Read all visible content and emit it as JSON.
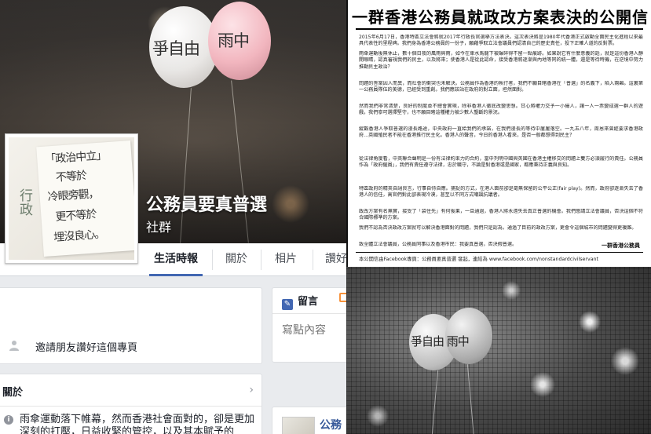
{
  "cover": {
    "balloon_left_text": "爭自由",
    "balloon_right_text": "雨中"
  },
  "profile": {
    "note_lines": [
      "「政治中立」",
      "不等於",
      "冷眼旁觀，",
      "更不等於",
      "埋沒良心。"
    ],
    "side_note": "行政"
  },
  "page": {
    "name": "公務員要真普選",
    "category": "社群"
  },
  "tabs": [
    {
      "label": "生活時報",
      "active": true
    },
    {
      "label": "關於",
      "active": false
    },
    {
      "label": "相片",
      "active": false
    },
    {
      "label": "讚好",
      "active": false
    }
  ],
  "invite": {
    "text": "邀請朋友讚好這個專頁"
  },
  "about": {
    "title": "關於",
    "text": "雨傘運動落下帷幕，然而香港社會面對的，卻是更加深刻的打壓，日益收緊的管控，以及其本賦予的"
  },
  "composer": {
    "tab_label": "留言",
    "placeholder": "寫點內容"
  },
  "post": {
    "name": "公務"
  },
  "letter": {
    "title": "一群香港公務員就政改方案表決的公開信",
    "paragraphs": [
      "2015年6月17日，香港特區立法會將就2017年行政長官選舉方法表決。這次表決將是1980年代香港正式啟動全面民主化進程以來最具代表性的里程碑。我們身為香港公務員的一份子，願藉爭取立法會議員們認清自己的歷史責任，投下正確人道的反對票。",
      "雨傘運動後無休止，數十個日夜的風雨與雨，如今在車水馬龍下被碾碎得不留一點痕跡。如果說它有什麼意義的話，就是這份香港人靜開眼睛，認真審視我們的民主，以及將來；使香港人是從此認命，接受香港將逐漸與內地等同的統一體，還是等待時機，在逆境中努力推動民主政治？",
      "問題的答案因人而異，而社會的衝突也未解決。公務員作為香港的執行者，我們不願目睹香港在「普選」的名義下，陷入兩難。這裏第一公務員隊伍的美德，已經受到重創。我們應該站在政府的對立面，坦然面對。",
      "然而我們非常清楚，良好的制度並不總會實現，除非香港人徹底改變思想。甘心將權力交予一小撮人，讓一人一票變成選一群人的遊戲，我們寧可選擇堅守，也不願目睹這種權力被少數人壟斷的景況。",
      "縱觀香港人爭取普選的漫長路途，中央政府一直給我們的承諾，在我們漫長的等待中屢屢落空。一九五八年，周恩來曾經要求香港政府…英國殖民者不能在香港推行民主化。香港人的聲音，今日的香港人看來，是否一般都想得到民主？",
      "從法律角度看，中英聯合聲明是一份有法律約束力的合約，當中列明中國與英國在香港主權移交的問題上雙方必須履行的責任。公務員作為「政府僱員」，我們有責任遵守法律，忠於職守，不論是對香港或是國家，都應秉持正義與良知。",
      "特區政府的精英自詡良言，行事自恃自應。捕捉的方式，在港人面前卻是毫無保留的公平公正(fair play)。然而，政府卻逐漸失去了香港人的信任，高官們對此卻表現冷漠，甚至以不同方式嘲諷抗議者。",
      "政改方案有名無實，接受了「袋住先」有何後果，一旦通過，香港人將永遠失去真正普選的機會。我們懇請立法會議員，否決這個不符合國際標準的方案。",
      "我們不認為否決政改方案就可以解決香港面對的問題，我們只是認為，通過了目前的政改方案，更會令這個城市的問題變得更複雜。",
      "致全體立法會議員，公務員同事以及香港市民：我要真普選，否決假普選。"
    ],
    "signature": "一群香港公務員",
    "footer": "本公開信由Facebook專頁：公務員要真普選 發起，連結為 www.facebook.com/nonstandardcivilservant"
  },
  "mosaic": {
    "text": "爭自由 雨中"
  },
  "colors": {
    "accent": "#4267b2",
    "link": "#365899",
    "background": "#e9ebee"
  }
}
